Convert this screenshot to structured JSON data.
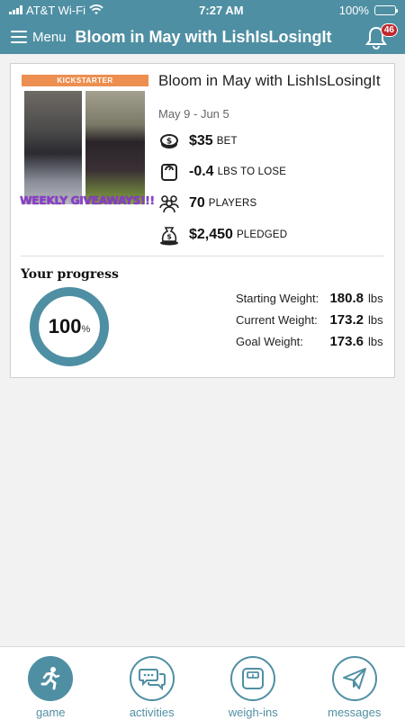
{
  "status_bar": {
    "carrier": "AT&T Wi-Fi",
    "time": "7:27 AM",
    "battery": "100%"
  },
  "nav": {
    "menu_label": "Menu",
    "title": "Bloom in May with LishIsLosingIt",
    "notification_count": "46"
  },
  "challenge": {
    "image_label": "KICKSTARTER",
    "image_caption": "WEEKLY GIVEAWAYS!!!",
    "title": "Bloom in May with LishIsLosingIt",
    "dates": "May 9 - Jun 5",
    "stats": [
      {
        "icon": "coin-icon",
        "value": "$35",
        "unit": "BET"
      },
      {
        "icon": "scale-icon",
        "value": "-0.4",
        "unit": "LBS TO LOSE"
      },
      {
        "icon": "players-icon",
        "value": "70",
        "unit": "PLAYERS"
      },
      {
        "icon": "money-bag-icon",
        "value": "$2,450",
        "unit": "PLEDGED"
      }
    ]
  },
  "progress": {
    "label": "Your progress",
    "value": "100",
    "unit": "%",
    "fraction": 1.0,
    "ring_color": "#4f8fa3"
  },
  "weights": [
    {
      "label": "Starting Weight:",
      "value": "180.8",
      "unit": "lbs"
    },
    {
      "label": "Current Weight:",
      "value": "173.2",
      "unit": "lbs"
    },
    {
      "label": "Goal Weight:",
      "value": "173.6",
      "unit": "lbs"
    }
  ],
  "tabs": [
    {
      "label": "game",
      "icon": "runner-icon",
      "active": true
    },
    {
      "label": "activities",
      "icon": "chat-bubbles-icon",
      "active": false
    },
    {
      "label": "weigh-ins",
      "icon": "scale-icon",
      "active": false
    },
    {
      "label": "messages",
      "icon": "paper-plane-icon",
      "active": false
    }
  ],
  "colors": {
    "brand": "#4f8fa3",
    "badge": "#c0282d",
    "kickstarter": "#ec8f50",
    "giveaway": "#8f3bd1"
  }
}
